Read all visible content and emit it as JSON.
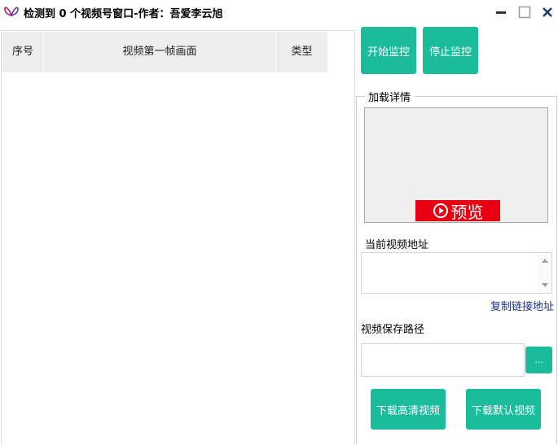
{
  "window": {
    "title": "检测到 0 个视频号窗口-作者：吾爱李云旭",
    "logo_icon": "butterfly-logo-icon",
    "controls": [
      "minimize-icon",
      "maximize-icon",
      "close-icon"
    ]
  },
  "table": {
    "columns": [
      "序号",
      "视频第一帧画面",
      "类型"
    ],
    "rows": []
  },
  "toolbar": {
    "start_label": "开始监控",
    "stop_label": "停止监控"
  },
  "details": {
    "group_title": "加载详情",
    "preview_label": "预览",
    "preview_icon": "play-circle-icon",
    "current_url_label": "当前视频地址",
    "current_url_value": "",
    "copy_link_label": "复制链接地址",
    "save_path_label": "视频保存路径",
    "save_path_value": "",
    "browse_label": "...",
    "download_hd_label": "下载高清视频",
    "download_default_label": "下载默认视频"
  },
  "colors": {
    "accent": "#1abc9c",
    "preview_red": "#e60012",
    "link_blue": "#1a2f8a",
    "header_bg": "#eeeeee"
  }
}
